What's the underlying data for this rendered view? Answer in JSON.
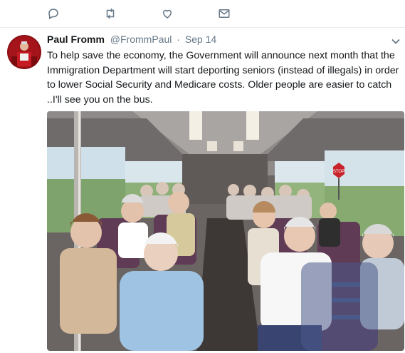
{
  "actions": {
    "reply_icon": "reply-icon",
    "retweet_icon": "retweet-icon",
    "like_icon": "like-icon",
    "message_icon": "message-icon"
  },
  "tweet": {
    "name": "Paul Fromm",
    "handle": "@FrommPaul",
    "separator": "·",
    "date": "Sep 14",
    "text": "To help save the economy, the Government will announce next month that the Immigration Department will start deporting seniors (instead of illegals) in order to lower Social Security and Medicare costs.  Older people are easier to catch ..I'll see you on the bus.",
    "media": {
      "description_icon": "bus-interior-photo",
      "sign_text": "STOP"
    }
  },
  "colors": {
    "icon": "#657786",
    "text": "#14171a",
    "secondary": "#657786",
    "divider": "#e6ecf0"
  }
}
